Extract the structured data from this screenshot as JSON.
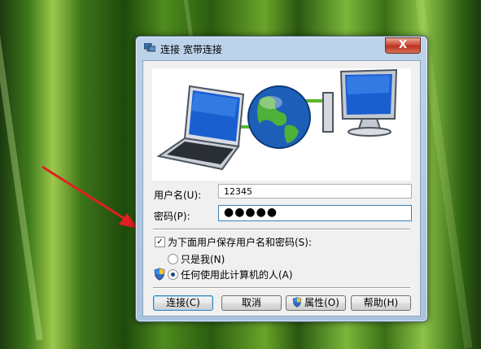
{
  "window": {
    "title": "连接 宽带连接",
    "close_glyph": "X"
  },
  "form": {
    "username_label": "用户名(U):",
    "username_value": "12345",
    "password_label": "密码(P):",
    "password_value": "●●●●●",
    "save_checkbox_label": "为下面用户保存用户名和密码(S):",
    "save_checked": true,
    "radio_me_label": "只是我(N)",
    "radio_anyone_label": "任何使用此计算机的人(A)",
    "selected_radio": "anyone"
  },
  "buttons": {
    "connect": "连接(C)",
    "cancel": "取消",
    "properties": "属性(O)",
    "help": "帮助(H)"
  },
  "icons": [
    "network-connection-icon",
    "close-icon",
    "laptop-icon",
    "globe-icon",
    "desktop-computer-icon",
    "uac-shield-icon",
    "red-arrow-annotation"
  ],
  "colors": {
    "annotation_arrow": "#e02020",
    "link_line": "#5ab82c",
    "focus_border": "#3c7fb1"
  }
}
